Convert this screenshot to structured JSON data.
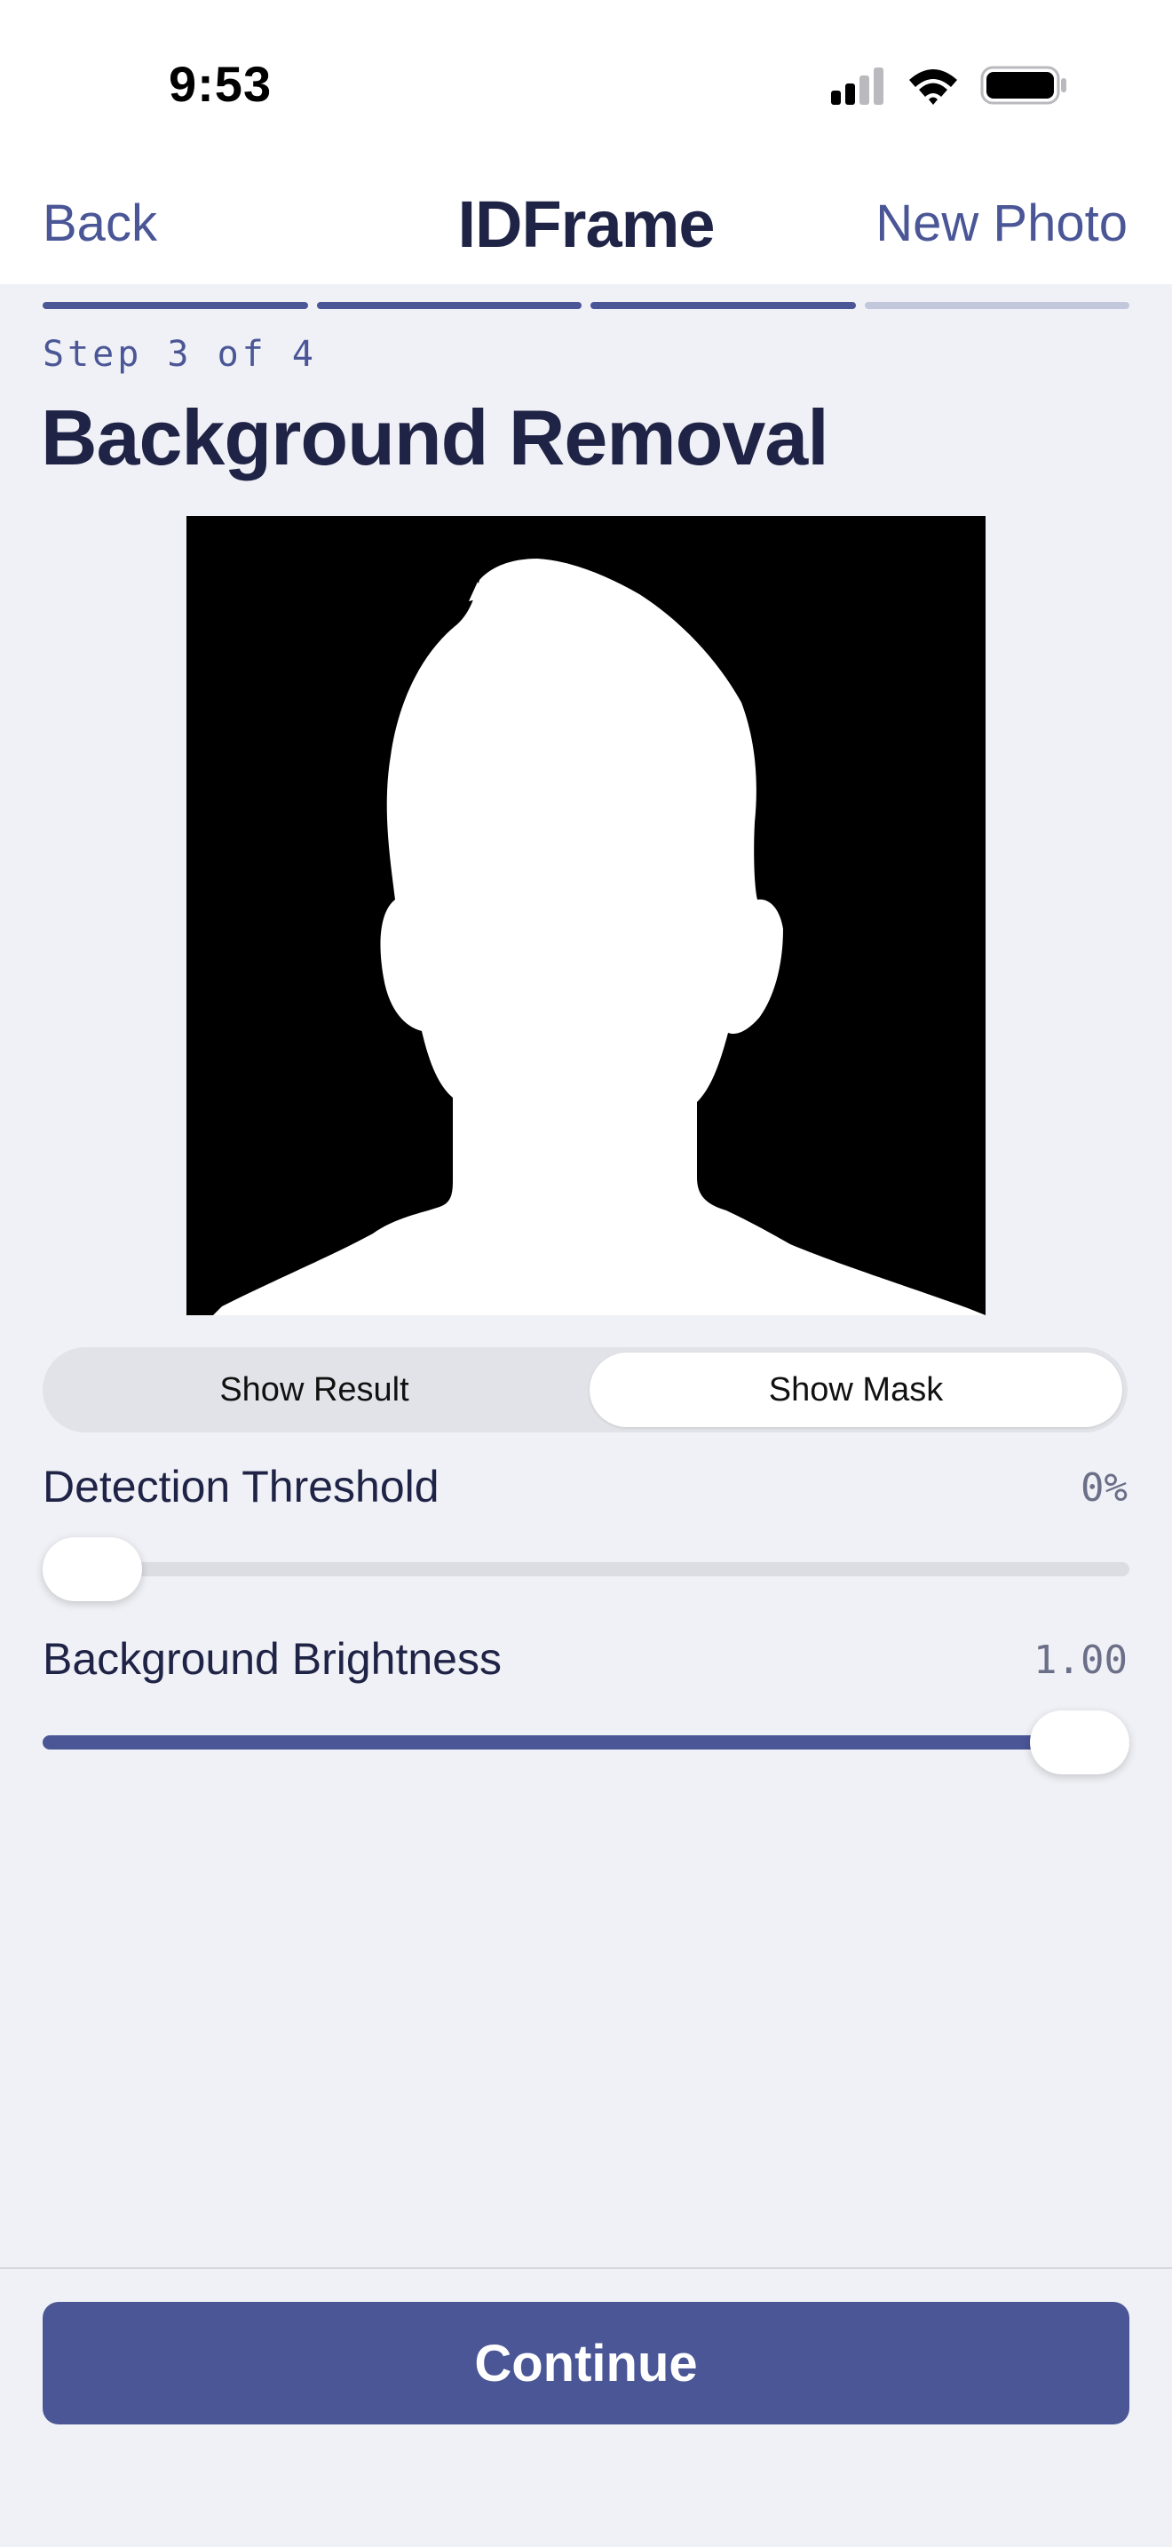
{
  "status_bar": {
    "time": "9:53",
    "icons": [
      "cellular-signal-icon",
      "wifi-icon",
      "battery-icon"
    ]
  },
  "nav": {
    "back_label": "Back",
    "title": "IDFrame",
    "new_photo_label": "New Photo"
  },
  "progress": {
    "total_steps": 4,
    "completed_steps": 3
  },
  "step_label": "Step 3 of 4",
  "page_title": "Background Removal",
  "preview": {
    "mode": "mask"
  },
  "view_toggle": {
    "options": [
      "Show Result",
      "Show Mask"
    ],
    "selected": "Show Mask"
  },
  "sliders": {
    "threshold": {
      "label": "Detection Threshold",
      "value_text": "0%",
      "fraction": 0.0
    },
    "brightness": {
      "label": "Background Brightness",
      "value_text": "1.00",
      "fraction": 1.0
    }
  },
  "continue_label": "Continue",
  "colors": {
    "accent": "#4a5696",
    "background": "#f0f1f6",
    "title_text": "#1f2346",
    "progress_inactive": "#c3c7dc"
  }
}
